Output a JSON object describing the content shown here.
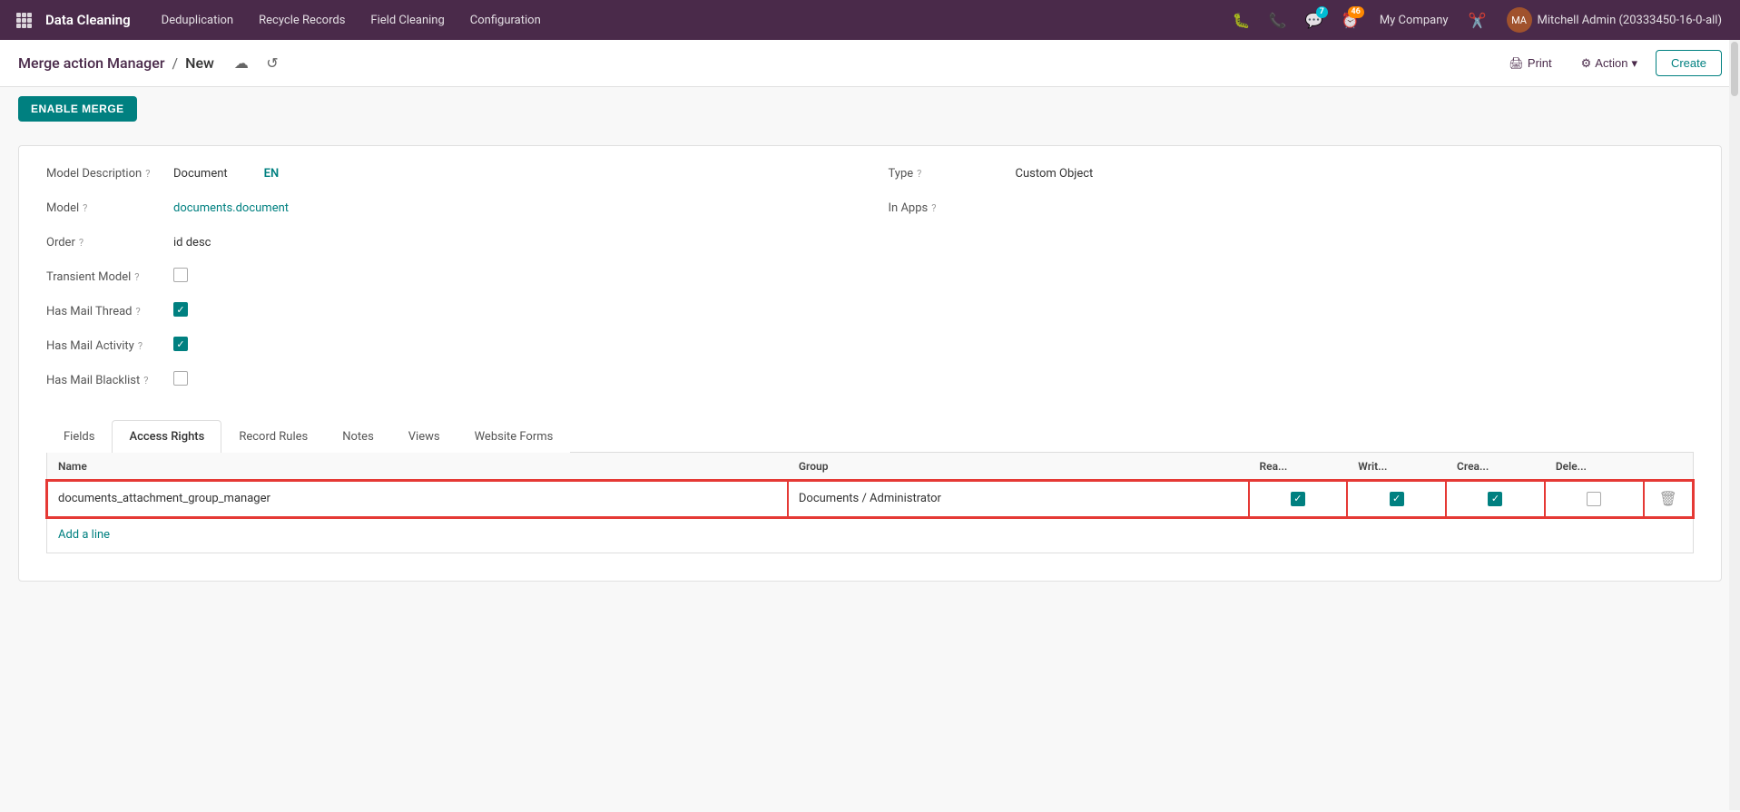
{
  "app": {
    "name": "Data Cleaning"
  },
  "navbar": {
    "brand": "Data Cleaning",
    "menu_items": [
      "Deduplication",
      "Recycle Records",
      "Field Cleaning",
      "Configuration"
    ],
    "icons": {
      "bug": "🐛",
      "phone": "📞",
      "chat": "💬",
      "clock": "⏰"
    },
    "chat_badge": "7",
    "clock_badge": "46",
    "company": "My Company",
    "user": "Mitchell Admin (20333450-16-0-all)"
  },
  "breadcrumb": {
    "parent": "Merge action Manager",
    "separator": "/",
    "current": "New"
  },
  "toolbar": {
    "print_label": "Print",
    "action_label": "Action",
    "create_label": "Create"
  },
  "enable_merge": {
    "label": "ENABLE MERGE"
  },
  "form": {
    "model_description_label": "Model Description",
    "model_description_value": "Document",
    "model_description_en": "EN",
    "type_label": "Type",
    "type_value": "Custom Object",
    "model_label": "Model",
    "model_value": "documents.document",
    "in_apps_label": "In Apps",
    "in_apps_value": "",
    "order_label": "Order",
    "order_value": "id desc",
    "transient_model_label": "Transient Model",
    "has_mail_thread_label": "Has Mail Thread",
    "has_mail_activity_label": "Has Mail Activity",
    "has_mail_blacklist_label": "Has Mail Blacklist"
  },
  "tabs": [
    {
      "id": "fields",
      "label": "Fields"
    },
    {
      "id": "access_rights",
      "label": "Access Rights",
      "active": true
    },
    {
      "id": "record_rules",
      "label": "Record Rules"
    },
    {
      "id": "notes",
      "label": "Notes"
    },
    {
      "id": "views",
      "label": "Views"
    },
    {
      "id": "website_forms",
      "label": "Website Forms"
    }
  ],
  "table": {
    "columns": [
      {
        "id": "name",
        "label": "Name"
      },
      {
        "id": "group",
        "label": "Group"
      },
      {
        "id": "read",
        "label": "Rea..."
      },
      {
        "id": "write",
        "label": "Writ..."
      },
      {
        "id": "create",
        "label": "Crea..."
      },
      {
        "id": "delete",
        "label": "Dele..."
      },
      {
        "id": "action",
        "label": ""
      }
    ],
    "rows": [
      {
        "name": "documents_attachment_group_manager",
        "group": "Documents / Administrator",
        "read": true,
        "write": true,
        "create": true,
        "delete": false,
        "highlighted": true
      }
    ],
    "add_line_label": "Add a line"
  }
}
